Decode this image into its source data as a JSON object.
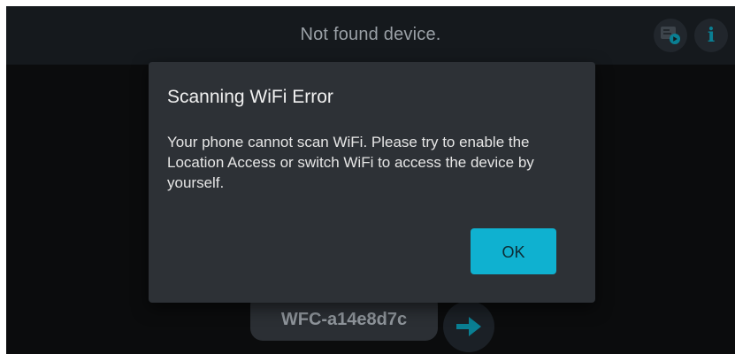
{
  "topbar": {
    "title": "Not found device.",
    "media_icon": "screen-play-icon",
    "info_icon": "info-icon",
    "info_glyph": "i"
  },
  "device": {
    "name": "WFC-a14e8d7c",
    "go_icon": "arrow-right-icon"
  },
  "dialog": {
    "title": "Scanning WiFi Error",
    "message": "Your phone cannot scan WiFi.  Please try to enable the Location Access or switch WiFi to access the device by yourself.",
    "ok_label": "OK"
  },
  "colors": {
    "accent": "#0fb1d0",
    "dialog_background": "#2d3136",
    "screen_background": "#0b0c0d"
  }
}
